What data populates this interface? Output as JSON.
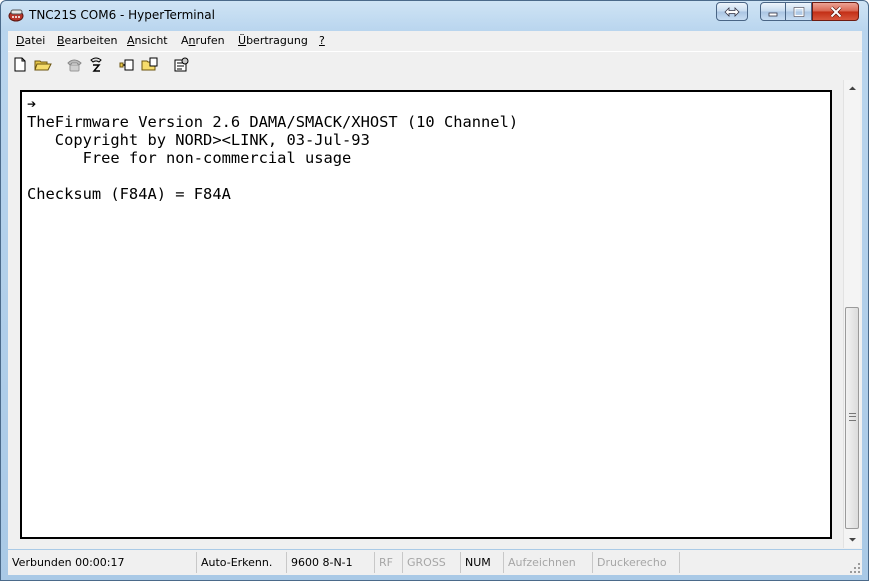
{
  "window": {
    "title": "TNC21S COM6 - HyperTerminal"
  },
  "menu": [
    {
      "label": "Datei"
    },
    {
      "label": "Bearbeiten"
    },
    {
      "label": "Ansicht"
    },
    {
      "label": "Anrufen"
    },
    {
      "label": "Übertragung"
    },
    {
      "label": "?"
    }
  ],
  "toolbar": {
    "icons": [
      "new-file-icon",
      "open-folder-icon",
      "phone-icon",
      "disconnect-icon",
      "send-file-icon",
      "receive-file-icon",
      "properties-icon"
    ]
  },
  "terminal": {
    "lines": [
      "➔",
      "TheFirmware Version 2.6 DAMA/SMACK/XHOST (10 Channel)",
      "   Copyright by NORD><LINK, 03-Jul-93",
      "      Free for non-commercial usage",
      "",
      "Checksum (F84A) = F84A"
    ]
  },
  "status": {
    "connected": "Verbunden 00:00:17",
    "detect": "Auto-Erkenn.",
    "settings": "9600 8-N-1",
    "rf": "RF",
    "caps": "GROSS",
    "num": "NUM",
    "capture": "Aufzeichnen",
    "echo": "Druckerecho"
  },
  "colors": {
    "title_gradient_top": "#cfe4f5",
    "close_button": "#c22d14",
    "terminal_background": "#ffffff",
    "disabled_text": "#a6a6a6"
  }
}
